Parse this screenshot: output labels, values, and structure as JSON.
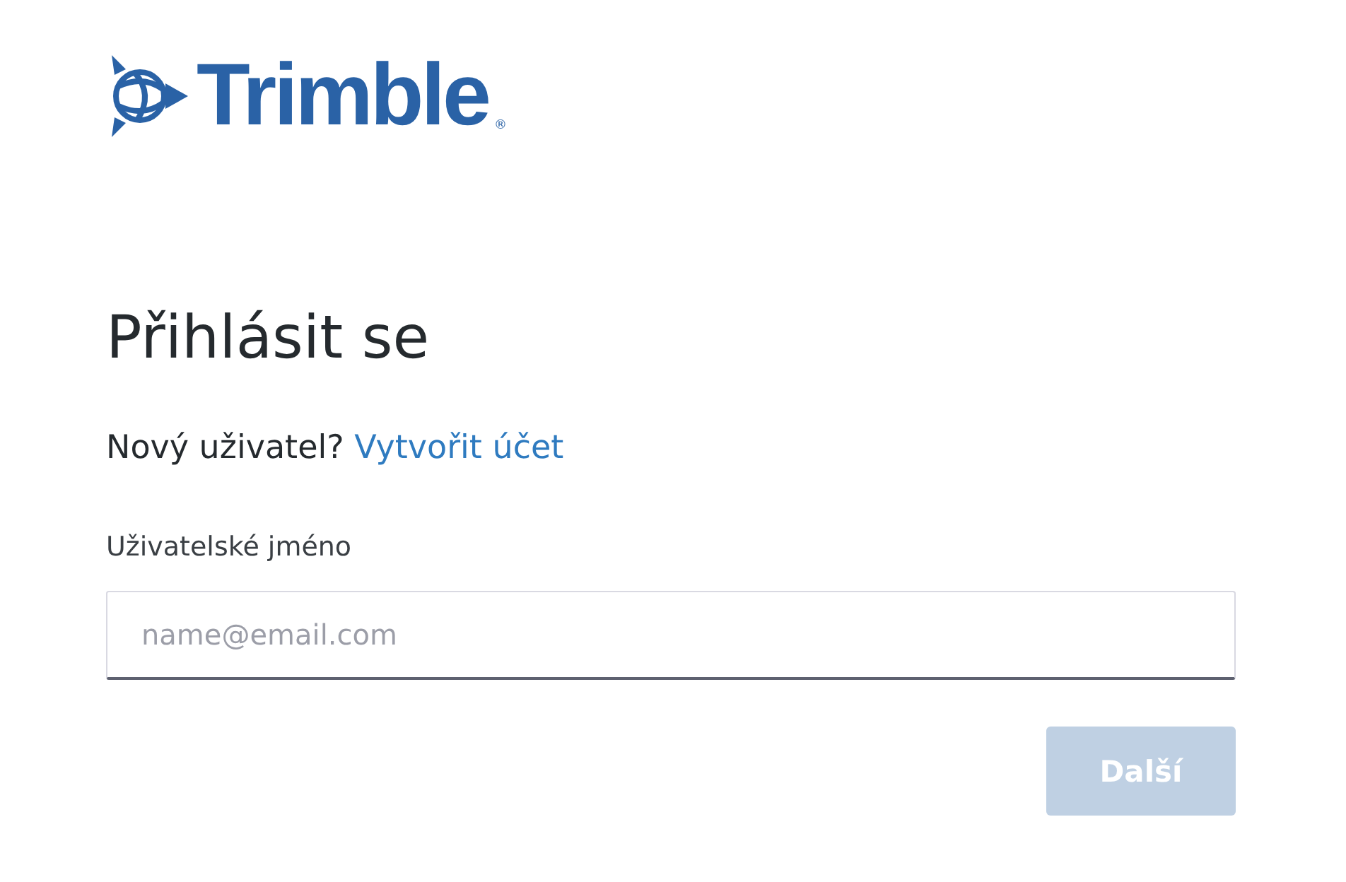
{
  "logo": {
    "wordmark": "Trimble",
    "mark": "®"
  },
  "heading": "Přihlásit se",
  "signup": {
    "prompt": "Nový uživatel?",
    "link": "Vytvořit účet"
  },
  "username": {
    "label": "Uživatelské jméno",
    "placeholder": "name@email.com"
  },
  "next_button": {
    "label": "Další",
    "disabled": true
  }
}
